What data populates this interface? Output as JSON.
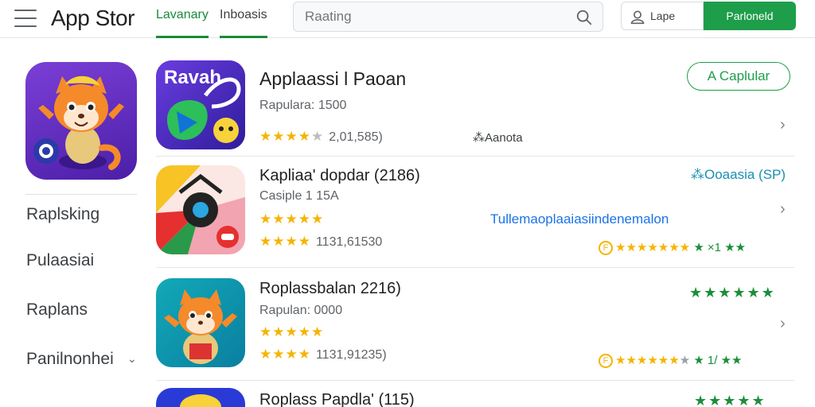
{
  "header": {
    "title": "App Stor",
    "tabs": [
      {
        "label": "Lavanary"
      },
      {
        "label": "Inboasis"
      }
    ],
    "search_placeholder": "Raating",
    "user_label": "Lape",
    "primary_button": "Parloneld"
  },
  "sidebar": {
    "items": [
      {
        "label": "Raplsking"
      },
      {
        "label": "Pulaasiai"
      },
      {
        "label": "Raplans"
      },
      {
        "label": "Panilnonhei"
      }
    ]
  },
  "apps": [
    {
      "name": "Applaassi l Paoan",
      "sub": "Rapulara: 1500",
      "stars": "★★★★",
      "stars_grey": "★",
      "count": "2,01,585)",
      "note": "⁂Aanota",
      "button": "A Caplular",
      "icon_text": "Ravah"
    },
    {
      "name": "Kapliaa' dopdar (2186)",
      "sub": "Casiple 1 15A",
      "stars_line1": "★★★★★",
      "stars_line1_text": "Tullemaoplaaiasiindenemalon",
      "stars_line2": "★★★★",
      "count": "1131,61530",
      "teal_note": "⁂Ooaasia (SP)",
      "right_rating": {
        "coin": "F",
        "stars": "★★★★★★★",
        "tail": "★ ×1 ★★"
      }
    },
    {
      "name": "Roplassbalan 2216)",
      "sub": "Rapulan: 0000",
      "stars_line1": "★★★★★",
      "stars_line2": "★★★★",
      "count": "1131,91235)",
      "top_right_stars": "★★★★★★",
      "right_rating": {
        "coin": "F",
        "stars": "★★★★★★",
        "grey_star": "★",
        "tail": "★ 1/ ★★"
      }
    },
    {
      "name": "Roplass Papdla' (115)",
      "top_right_stars": "★★★★★"
    }
  ],
  "colors": {
    "accent_green": "#1e9e4a",
    "star_gold": "#f5b400",
    "link_blue": "#1a73e8"
  },
  "icons": {
    "menu": "hamburger-icon",
    "search": "search-icon",
    "user": "user-icon",
    "chevron": "chevron-right-icon"
  }
}
